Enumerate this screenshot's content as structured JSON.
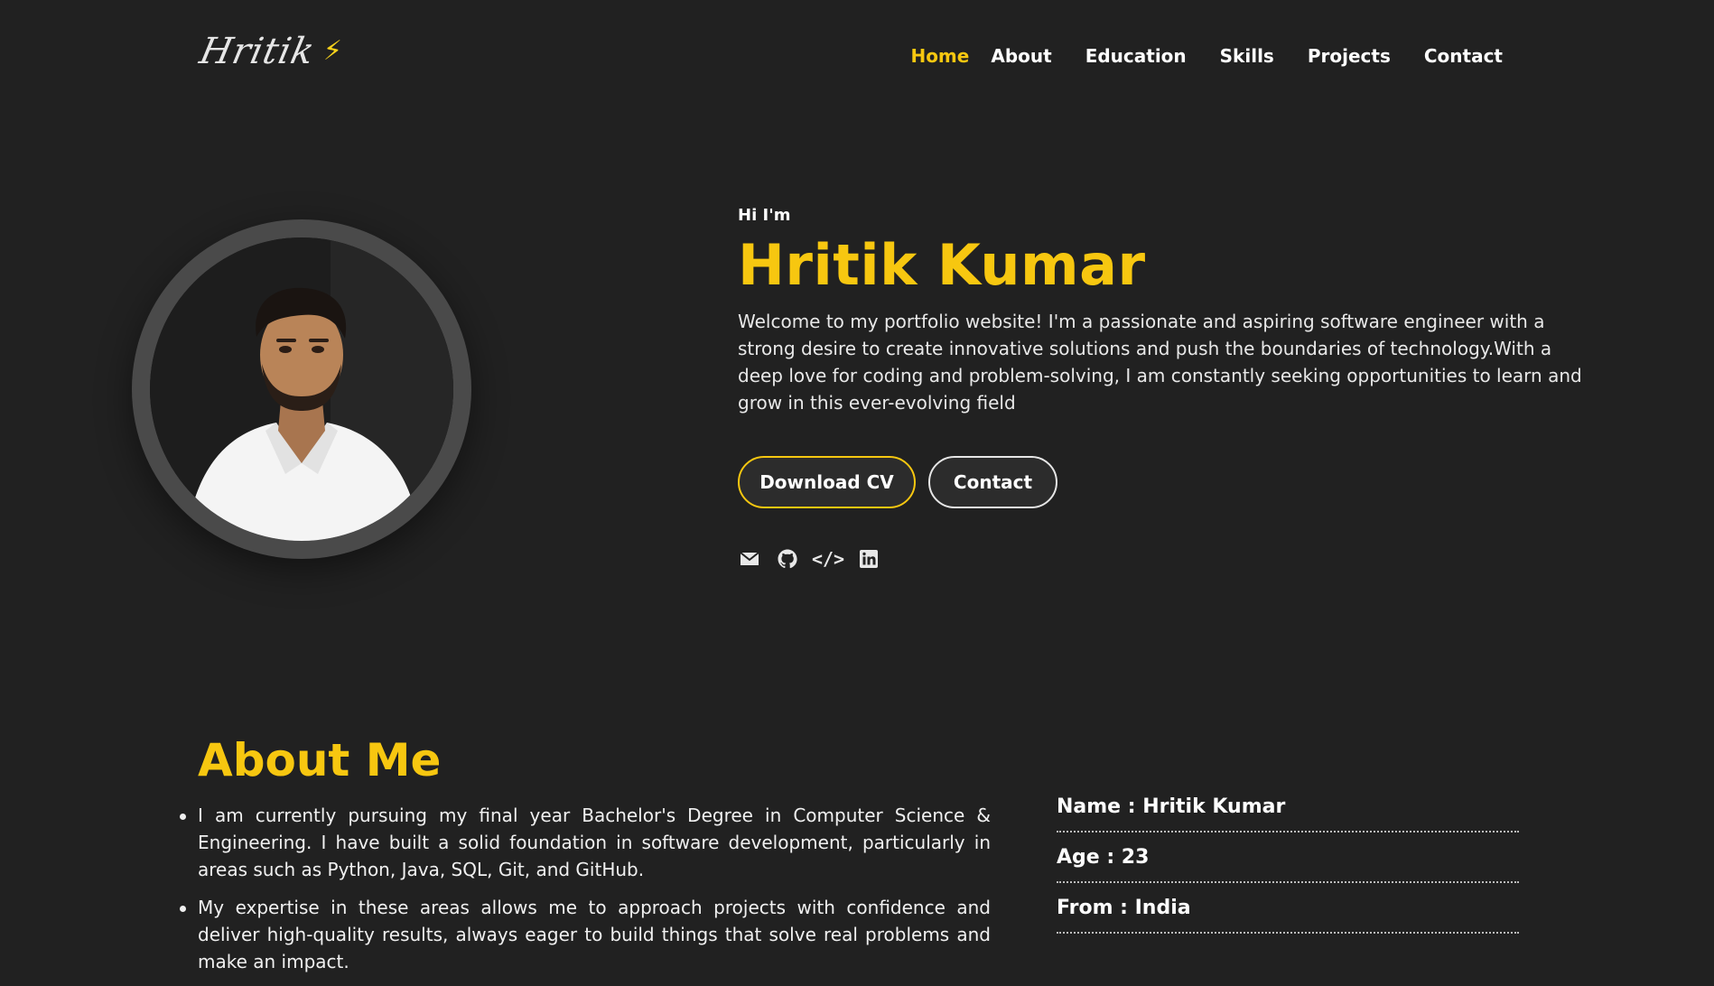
{
  "header": {
    "logo_text": "Hritik",
    "logo_icon": "lightning-bolt-icon",
    "nav": [
      {
        "label": "Home",
        "active": true
      },
      {
        "label": "About",
        "active": false
      },
      {
        "label": "Education",
        "active": false
      },
      {
        "label": "Skills",
        "active": false
      },
      {
        "label": "Projects",
        "active": false
      },
      {
        "label": "Contact",
        "active": false
      }
    ]
  },
  "hero": {
    "greeting": "Hi I'm",
    "name": "Hritik Kumar",
    "description": "Welcome to my portfolio website! I'm a passionate and aspiring software engineer with a strong desire to create innovative solutions and push the boundaries of technology.With a deep love for coding and problem-solving, I am constantly seeking opportunities to learn and grow in this ever-evolving field",
    "buttons": {
      "download_cv": "Download CV",
      "contact": "Contact"
    },
    "socials": [
      {
        "icon": "envelope-icon"
      },
      {
        "icon": "github-icon"
      },
      {
        "icon": "code-icon"
      },
      {
        "icon": "linkedin-icon"
      }
    ]
  },
  "about": {
    "title": "About Me",
    "points": [
      "I am currently pursuing my final year Bachelor's Degree in Computer Science & Engineering. I have built a solid foundation in software development, particularly in areas such as Python, Java, SQL, Git, and GitHub.",
      "My expertise in these areas allows me to approach projects with confidence and deliver high-quality results, always eager to build things that solve real problems and make an impact."
    ],
    "info": [
      {
        "label": "Name : Hritik Kumar"
      },
      {
        "label": "Age : 23"
      },
      {
        "label": "From : India"
      }
    ]
  },
  "colors": {
    "background": "#212121",
    "accent": "#f7c710",
    "text": "#ffffff"
  }
}
